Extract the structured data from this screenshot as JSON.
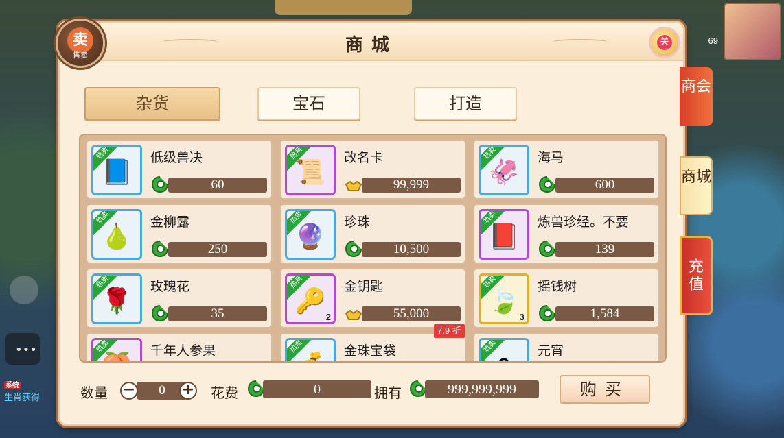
{
  "window": {
    "title": "商城"
  },
  "header": {
    "sell_label": "售卖",
    "sell_glyph": "卖",
    "close_glyph": "关"
  },
  "categories": [
    {
      "label": "杂货",
      "active": true
    },
    {
      "label": "宝石",
      "active": false
    },
    {
      "label": "打造",
      "active": false
    }
  ],
  "items": [
    {
      "name": "低级兽决",
      "price": "60",
      "currency": "silver",
      "tier": "blue",
      "icon": "skill-book-icon",
      "glyph": "📘",
      "badge": "热卖",
      "count": ""
    },
    {
      "name": "改名卡",
      "price": "99,999",
      "currency": "ingot",
      "tier": "purple",
      "icon": "scroll-icon",
      "glyph": "📜",
      "badge": "热卖",
      "count": ""
    },
    {
      "name": "海马",
      "price": "600",
      "currency": "silver",
      "tier": "blue",
      "icon": "seahorse-icon",
      "glyph": "🦑",
      "badge": "热卖",
      "count": ""
    },
    {
      "name": "金柳露",
      "price": "250",
      "currency": "silver",
      "tier": "blue",
      "icon": "gourd-icon",
      "glyph": "🍐",
      "badge": "热卖",
      "count": ""
    },
    {
      "name": "珍珠",
      "price": "10,500",
      "currency": "silver",
      "tier": "blue",
      "icon": "pearl-icon",
      "glyph": "🔮",
      "badge": "热卖",
      "count": ""
    },
    {
      "name": "炼兽珍经。不要",
      "price": "139",
      "currency": "silver",
      "tier": "purple",
      "icon": "book-icon",
      "glyph": "📕",
      "badge": "热卖",
      "count": ""
    },
    {
      "name": "玫瑰花",
      "price": "35",
      "currency": "silver",
      "tier": "blue",
      "icon": "rose-icon",
      "glyph": "🌹",
      "badge": "热卖",
      "count": ""
    },
    {
      "name": "金钥匙",
      "price": "55,000",
      "currency": "ingot",
      "tier": "purple",
      "icon": "key-icon",
      "glyph": "🔑",
      "badge": "热卖",
      "count": "2"
    },
    {
      "name": "摇钱树",
      "price": "1,584",
      "currency": "silver",
      "tier": "gold",
      "icon": "money-tree-icon",
      "glyph": "🍃",
      "badge": "热卖",
      "count": "3"
    },
    {
      "name": "千年人参果",
      "price": "",
      "currency": "silver",
      "tier": "purple",
      "icon": "ginseng-fruit-icon",
      "glyph": "🍑",
      "badge": "热卖",
      "count": ""
    },
    {
      "name": "金珠宝袋",
      "price": "",
      "currency": "silver",
      "tier": "blue",
      "icon": "treasure-bag-icon",
      "glyph": "💰",
      "badge": "热卖",
      "count": ""
    },
    {
      "name": "元宵",
      "price": "",
      "currency": "silver",
      "tier": "blue",
      "icon": "dumpling-icon",
      "glyph": "⚪",
      "badge": "热卖",
      "count": ""
    }
  ],
  "discount_tag": "7.9 折",
  "purchase": {
    "quantity_label": "数量",
    "quantity_value": "0",
    "minus": "−",
    "plus": "+",
    "cost_label": "花费",
    "cost_value": "0",
    "own_label": "拥有",
    "own_value": "999,999,999",
    "buy_label": "购买"
  },
  "side_tabs": [
    "商会",
    "商城",
    "充值"
  ],
  "background": {
    "level": "69",
    "system_tag": "系统",
    "system_text": "生肖获得"
  },
  "colors": {
    "panel_bg": "#fbeedb",
    "price_bar": "#7a5a44",
    "hot_badge": "#2aa43a",
    "discount": "#e43a3a",
    "tier_blue": "#4aa8e0",
    "tier_purple": "#b14ad0",
    "tier_gold": "#e0b020"
  }
}
